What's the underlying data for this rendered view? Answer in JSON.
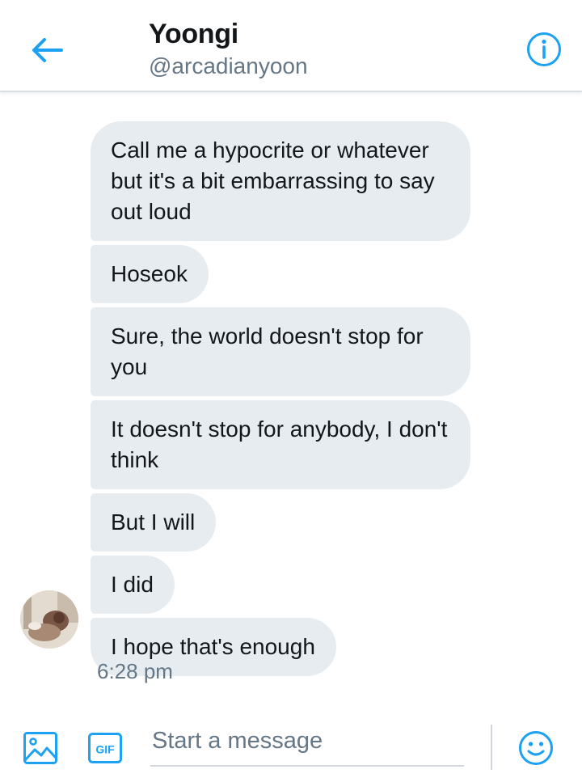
{
  "header": {
    "title": "Yoongi",
    "handle": "@arcadianyoon",
    "back_icon": "arrow-left-icon",
    "info_icon": "info-circle-icon"
  },
  "messages": [
    {
      "text": "Call me a hypocrite or whatever but it's a bit embarrassing to say out loud"
    },
    {
      "text": "Hoseok"
    },
    {
      "text": "Sure, the world doesn't stop for you"
    },
    {
      "text": "It doesn't stop for anybody, I don't think"
    },
    {
      "text": "But I will"
    },
    {
      "text": "I did"
    },
    {
      "text": "I hope that's enough"
    }
  ],
  "timestamp": "6:28 pm",
  "composer": {
    "placeholder": "Start a message",
    "value": "",
    "media_icon": "image-icon",
    "gif_icon": "gif-icon",
    "gif_label": "GIF",
    "emoji_icon": "smiley-icon"
  },
  "colors": {
    "accent": "#1da1f2",
    "bubble_bg": "#e6ecf0",
    "secondary_text": "#657786"
  }
}
